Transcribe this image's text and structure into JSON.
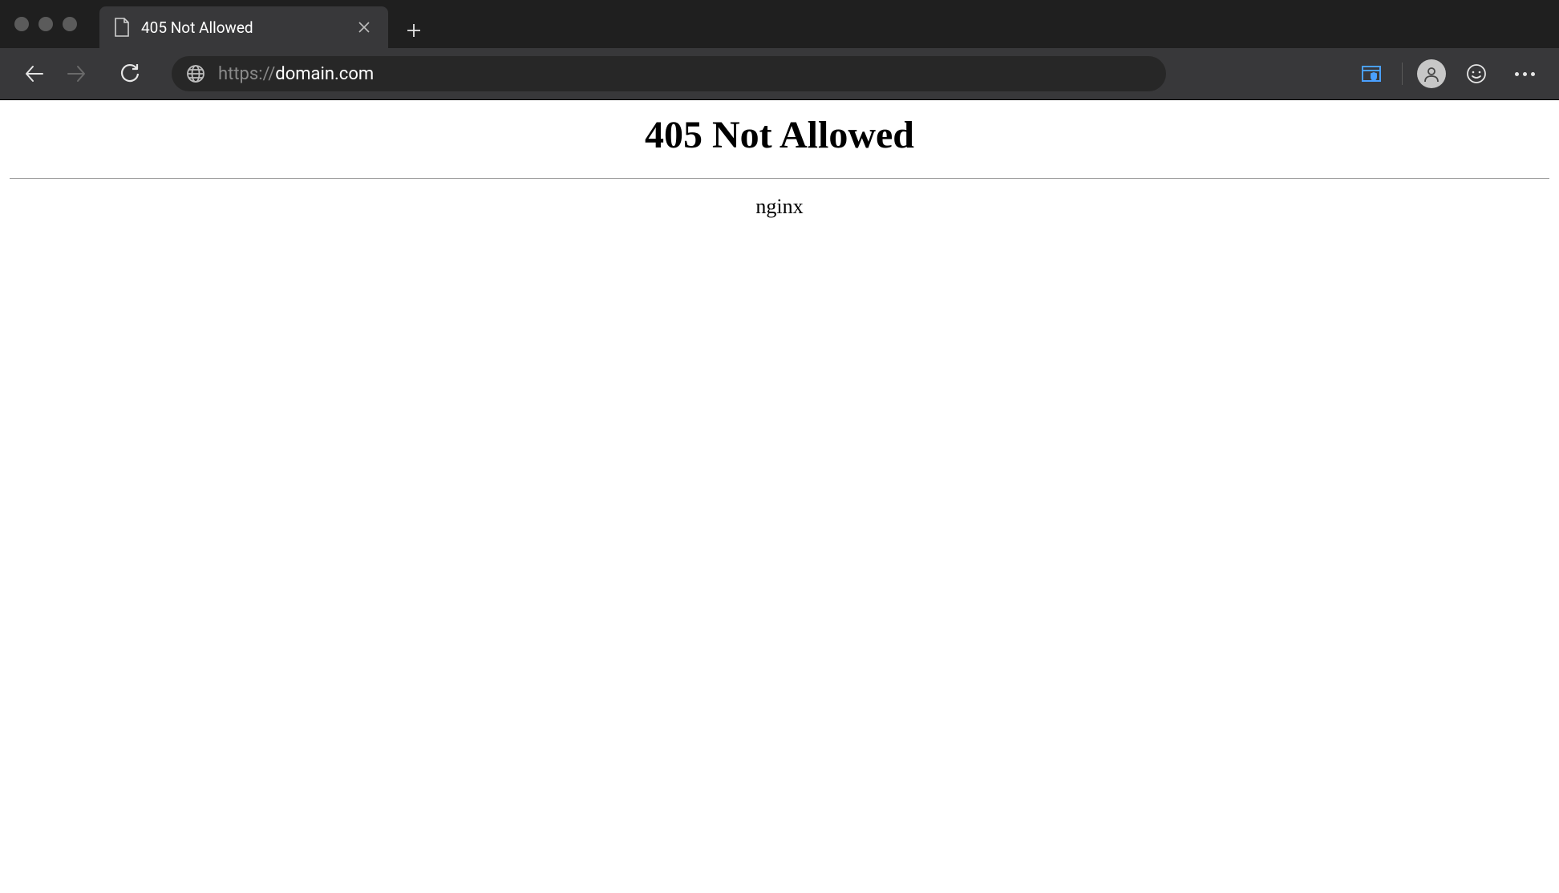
{
  "tab": {
    "title": "405 Not Allowed"
  },
  "address": {
    "protocol": "https://",
    "domain": "domain.com"
  },
  "page": {
    "heading": "405 Not Allowed",
    "server": "nginx"
  }
}
